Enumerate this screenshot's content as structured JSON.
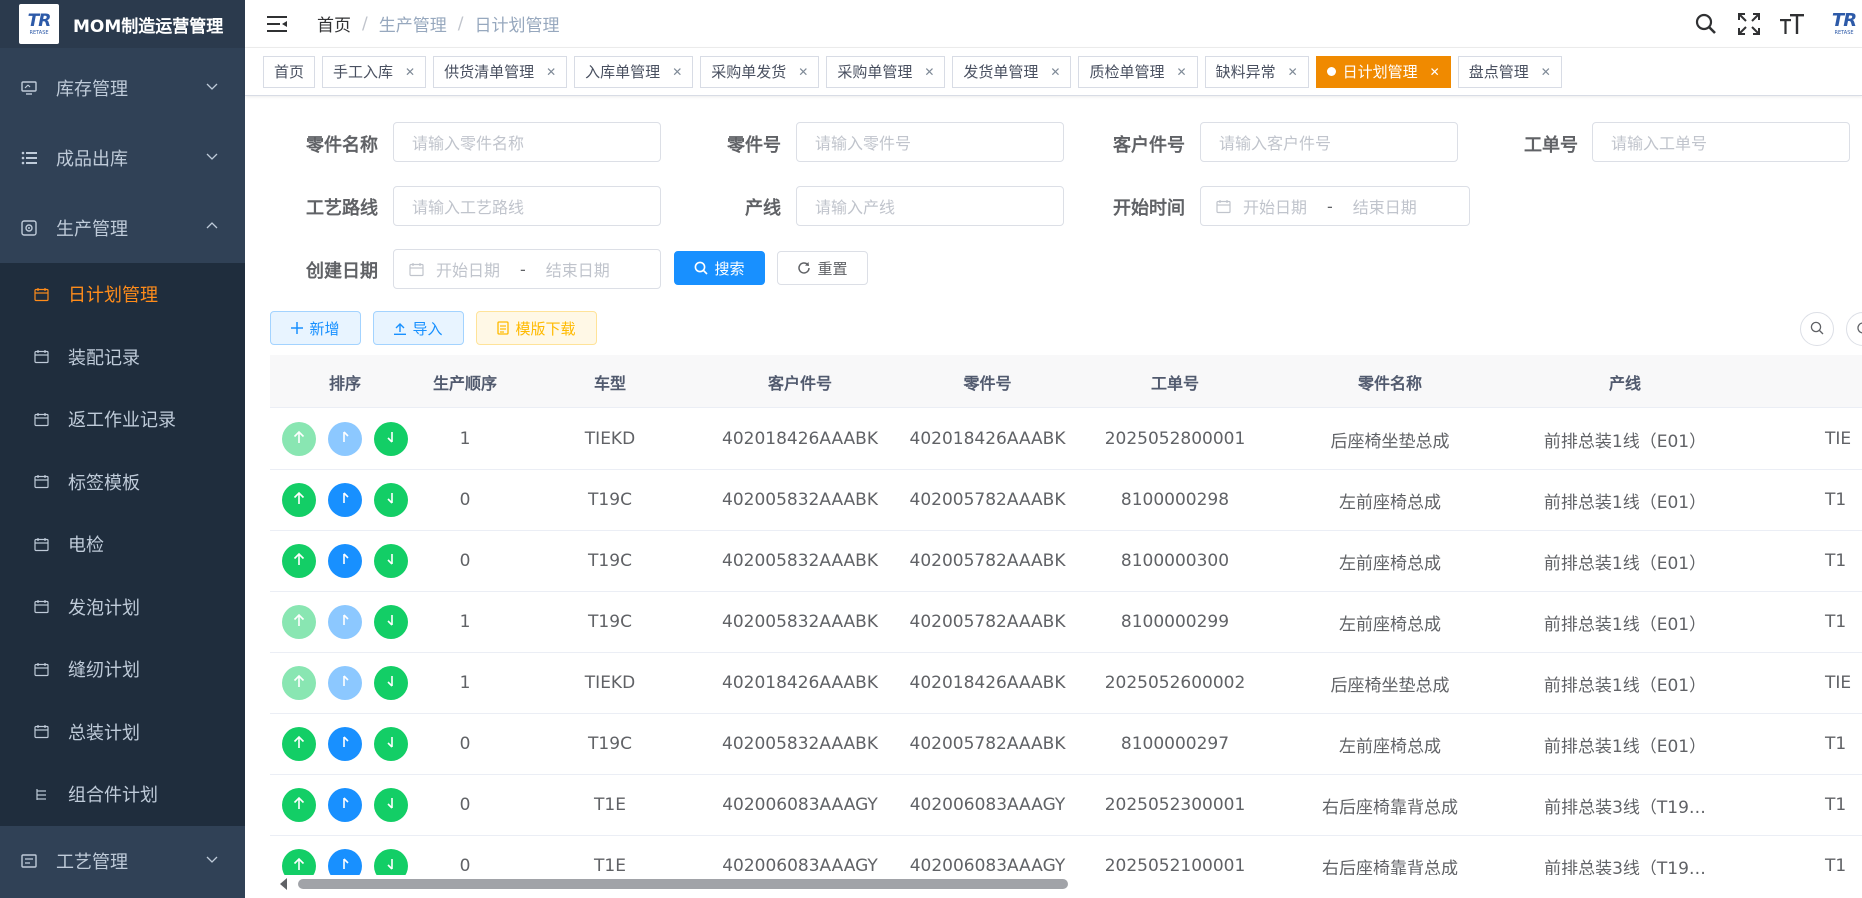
{
  "app": {
    "title": "MOM制造运营管理",
    "logo_text": "TR",
    "logo_sub": "RETASE"
  },
  "sidebar": {
    "groups": [
      {
        "label": "库存管理",
        "icon": "monitor-icon",
        "expanded": false
      },
      {
        "label": "成品出库",
        "icon": "list-icon",
        "expanded": false
      },
      {
        "label": "生产管理",
        "icon": "production-icon",
        "expanded": true
      }
    ],
    "sub_items": [
      {
        "label": "日计划管理",
        "active": true
      },
      {
        "label": "装配记录"
      },
      {
        "label": "返工作业记录"
      },
      {
        "label": "标签模板"
      },
      {
        "label": "电检"
      },
      {
        "label": "发泡计划"
      },
      {
        "label": "缝纫计划"
      },
      {
        "label": "总装计划"
      },
      {
        "label": "组合件计划"
      }
    ],
    "bottom_group": {
      "label": "工艺管理",
      "icon": "process-icon"
    }
  },
  "navbar": {
    "breadcrumb": [
      "首页",
      "生产管理",
      "日计划管理"
    ],
    "icons": [
      "search-icon",
      "fullscreen-icon",
      "font-size-icon"
    ]
  },
  "tags": [
    {
      "label": "首页",
      "closable": false
    },
    {
      "label": "手工入库",
      "closable": true
    },
    {
      "label": "供货清单管理",
      "closable": true
    },
    {
      "label": "入库单管理",
      "closable": true
    },
    {
      "label": "采购单发货",
      "closable": true
    },
    {
      "label": "采购单管理",
      "closable": true
    },
    {
      "label": "发货单管理",
      "closable": true
    },
    {
      "label": "质检单管理",
      "closable": true
    },
    {
      "label": "缺料异常",
      "closable": true
    },
    {
      "label": "日计划管理",
      "closable": true,
      "active": true
    },
    {
      "label": "盘点管理",
      "closable": true
    }
  ],
  "form": {
    "part_name": {
      "label": "零件名称",
      "placeholder": "请输入零件名称"
    },
    "part_no": {
      "label": "零件号",
      "placeholder": "请输入零件号"
    },
    "customer_part_no": {
      "label": "客户件号",
      "placeholder": "请输入客户件号"
    },
    "work_order": {
      "label": "工单号",
      "placeholder": "请输入工单号"
    },
    "route": {
      "label": "工艺路线",
      "placeholder": "请输入工艺路线"
    },
    "line": {
      "label": "产线",
      "placeholder": "请输入产线"
    },
    "start_time": {
      "label": "开始时间",
      "start_placeholder": "开始日期",
      "end_placeholder": "结束日期",
      "separator": "-"
    },
    "create_date": {
      "label": "创建日期",
      "start_placeholder": "开始日期",
      "end_placeholder": "结束日期",
      "separator": "-"
    },
    "search_label": "搜索",
    "reset_label": "重置"
  },
  "toolbar": {
    "add_label": "新增",
    "import_label": "导入",
    "template_label": "模版下载"
  },
  "table": {
    "columns": [
      "排序",
      "生产顺序",
      "车型",
      "客户件号",
      "零件号",
      "工单号",
      "零件名称",
      "产线"
    ],
    "rows": [
      {
        "seq": "1",
        "model": "TIEKD",
        "customer_part": "402018426AAABK",
        "part": "402018426AAABK",
        "work_order": "2025052800001",
        "part_name": "后座椅坐垫总成",
        "line": "前排总装1线（E01）",
        "extra": "TIE",
        "up_disabled": true
      },
      {
        "seq": "0",
        "model": "T19C",
        "customer_part": "402005832AAABK",
        "part": "402005782AAABK",
        "work_order": "8100000298",
        "part_name": "左前座椅总成",
        "line": "前排总装1线（E01）",
        "extra": "T1",
        "up_disabled": false
      },
      {
        "seq": "0",
        "model": "T19C",
        "customer_part": "402005832AAABK",
        "part": "402005782AAABK",
        "work_order": "8100000300",
        "part_name": "左前座椅总成",
        "line": "前排总装1线（E01）",
        "extra": "T1",
        "up_disabled": false
      },
      {
        "seq": "1",
        "model": "T19C",
        "customer_part": "402005832AAABK",
        "part": "402005782AAABK",
        "work_order": "8100000299",
        "part_name": "左前座椅总成",
        "line": "前排总装1线（E01）",
        "extra": "T1",
        "up_disabled": true
      },
      {
        "seq": "1",
        "model": "TIEKD",
        "customer_part": "402018426AAABK",
        "part": "402018426AAABK",
        "work_order": "2025052600002",
        "part_name": "后座椅坐垫总成",
        "line": "前排总装1线（E01）",
        "extra": "TIE",
        "up_disabled": true
      },
      {
        "seq": "0",
        "model": "T19C",
        "customer_part": "402005832AAABK",
        "part": "402005782AAABK",
        "work_order": "8100000297",
        "part_name": "左前座椅总成",
        "line": "前排总装1线（E01）",
        "extra": "T1",
        "up_disabled": false
      },
      {
        "seq": "0",
        "model": "T1E",
        "customer_part": "402006083AAAGY",
        "part": "402006083AAAGY",
        "work_order": "2025052300001",
        "part_name": "右后座椅靠背总成",
        "line": "前排总装3线（T19…",
        "extra": "T1",
        "up_disabled": false
      },
      {
        "seq": "0",
        "model": "T1E",
        "customer_part": "402006083AAAGY",
        "part": "402006083AAAGY",
        "work_order": "2025052100001",
        "part_name": "右后座椅靠背总成",
        "line": "前排总装3线（T19…",
        "extra": "T1",
        "up_disabled": false
      }
    ]
  },
  "colors": {
    "sidebar_bg": "#304156",
    "submenu_bg": "#1f2d3d",
    "active": "#ff8c1a",
    "primary": "#1890ff",
    "success": "#13ce66"
  }
}
